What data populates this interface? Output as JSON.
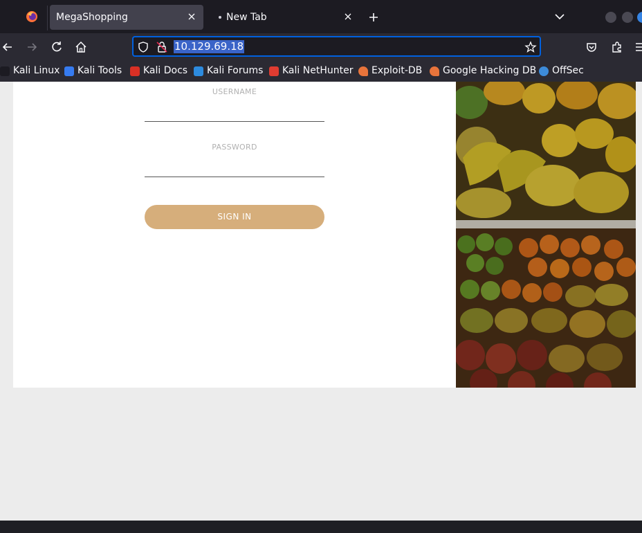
{
  "browser": {
    "tabs": [
      {
        "label": "MegaShopping",
        "active": true
      },
      {
        "label": "New Tab",
        "active": false
      }
    ],
    "url": "10.129.69.18",
    "bookmarks": [
      {
        "label": "Kali Linux",
        "icon": "kali-dragon-icon",
        "color": "#2d6bd6"
      },
      {
        "label": "Kali Tools",
        "icon": "kali-tools-icon",
        "color": "#367bf0"
      },
      {
        "label": "Kali Docs",
        "icon": "kali-docs-icon",
        "color": "#d93025"
      },
      {
        "label": "Kali Forums",
        "icon": "kali-forums-icon",
        "color": "#2d8bdf"
      },
      {
        "label": "Kali NetHunter",
        "icon": "kali-nethunter-icon",
        "color": "#e03c31"
      },
      {
        "label": "Exploit-DB",
        "icon": "exploit-db-icon",
        "color": "#e8743b"
      },
      {
        "label": "Google Hacking DB",
        "icon": "ghdb-icon",
        "color": "#e8743b"
      },
      {
        "label": "OffSec",
        "icon": "offsec-icon",
        "color": "#3d8bd9"
      }
    ]
  },
  "login": {
    "username_label": "USERNAME",
    "password_label": "PASSWORD",
    "signin_label": "SIGN IN",
    "accent_color": "#d6ae7b"
  },
  "hero_image": {
    "subject": "fruit-market-photo"
  }
}
